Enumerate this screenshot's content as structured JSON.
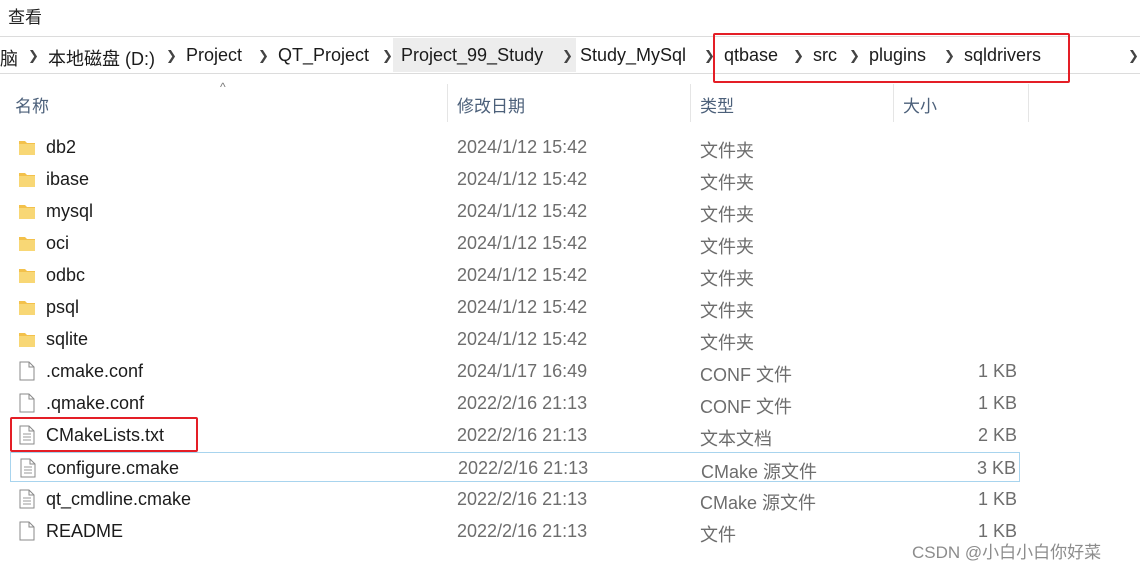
{
  "ribbon": {
    "view_tab": "查看"
  },
  "breadcrumb": [
    {
      "label": "脑"
    },
    {
      "label": "本地磁盘 (D:)"
    },
    {
      "label": "Project"
    },
    {
      "label": "QT_Project"
    },
    {
      "label": "Project_99_Study"
    },
    {
      "label": "Study_MySql"
    },
    {
      "label": "qtbase"
    },
    {
      "label": "src"
    },
    {
      "label": "plugins"
    },
    {
      "label": "sqldrivers"
    }
  ],
  "columns": {
    "name": "名称",
    "date": "修改日期",
    "type": "类型",
    "size": "大小"
  },
  "files": [
    {
      "name": "db2",
      "date": "2024/1/12 15:42",
      "type": "文件夹",
      "size": "",
      "icon": "folder-icon"
    },
    {
      "name": "ibase",
      "date": "2024/1/12 15:42",
      "type": "文件夹",
      "size": "",
      "icon": "folder-icon"
    },
    {
      "name": "mysql",
      "date": "2024/1/12 15:42",
      "type": "文件夹",
      "size": "",
      "icon": "folder-icon"
    },
    {
      "name": "oci",
      "date": "2024/1/12 15:42",
      "type": "文件夹",
      "size": "",
      "icon": "folder-icon"
    },
    {
      "name": "odbc",
      "date": "2024/1/12 15:42",
      "type": "文件夹",
      "size": "",
      "icon": "folder-icon"
    },
    {
      "name": "psql",
      "date": "2024/1/12 15:42",
      "type": "文件夹",
      "size": "",
      "icon": "folder-icon"
    },
    {
      "name": "sqlite",
      "date": "2024/1/12 15:42",
      "type": "文件夹",
      "size": "",
      "icon": "folder-icon"
    },
    {
      "name": ".cmake.conf",
      "date": "2024/1/17 16:49",
      "type": "CONF 文件",
      "size": "1 KB",
      "icon": "file-icon"
    },
    {
      "name": ".qmake.conf",
      "date": "2022/2/16 21:13",
      "type": "CONF 文件",
      "size": "1 KB",
      "icon": "file-icon"
    },
    {
      "name": "CMakeLists.txt",
      "date": "2022/2/16 21:13",
      "type": "文本文档",
      "size": "2 KB",
      "icon": "text-file-icon"
    },
    {
      "name": "configure.cmake",
      "date": "2022/2/16 21:13",
      "type": "CMake 源文件",
      "size": "3 KB",
      "icon": "text-file-icon"
    },
    {
      "name": "qt_cmdline.cmake",
      "date": "2022/2/16 21:13",
      "type": "CMake 源文件",
      "size": "1 KB",
      "icon": "text-file-icon"
    },
    {
      "name": "README",
      "date": "2022/2/16 21:13",
      "type": "文件",
      "size": "1 KB",
      "icon": "file-icon"
    }
  ],
  "watermark": "CSDN @小白小白你好菜",
  "colors": {
    "highlight_box": "#e41e26",
    "folder": "#f3c14b",
    "selection_border": "#a8d4ee"
  }
}
